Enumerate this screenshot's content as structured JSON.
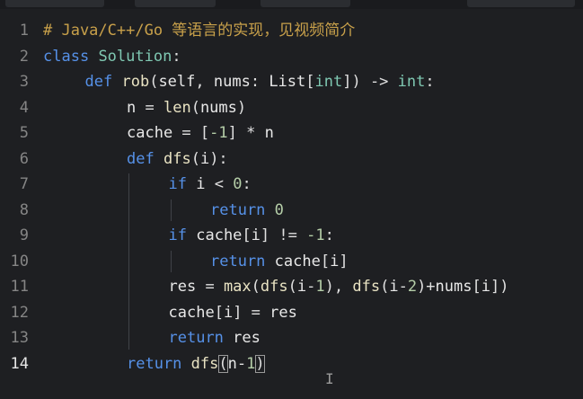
{
  "editor": {
    "language": "python",
    "colors": {
      "background": "#1e1f22",
      "comment": "#c8a04a",
      "keyword": "#5691e8",
      "function": "#e9e3c3",
      "number": "#b5cea8",
      "type": "#7fc8b2",
      "text": "#e8e8e8",
      "line_number": "#858585"
    },
    "current_line": 14,
    "lines": [
      {
        "number": "1",
        "indent": 0,
        "tokens": [
          {
            "t": "# Java/C++/Go 等语言的实现，见视频简介",
            "c": "cmt"
          }
        ]
      },
      {
        "number": "2",
        "indent": 0,
        "tokens": [
          {
            "t": "class",
            "c": "kw"
          },
          {
            "t": " ",
            "c": "op"
          },
          {
            "t": "Solution",
            "c": "typ"
          },
          {
            "t": ":",
            "c": "op"
          }
        ]
      },
      {
        "number": "3",
        "indent": 1,
        "tokens": [
          {
            "t": "def",
            "c": "kw"
          },
          {
            "t": " ",
            "c": "op"
          },
          {
            "t": "rob",
            "c": "fn"
          },
          {
            "t": "(",
            "c": "op"
          },
          {
            "t": "self",
            "c": "id"
          },
          {
            "t": ", ",
            "c": "op"
          },
          {
            "t": "nums",
            "c": "id"
          },
          {
            "t": ": ",
            "c": "op"
          },
          {
            "t": "List",
            "c": "id"
          },
          {
            "t": "[",
            "c": "op"
          },
          {
            "t": "int",
            "c": "typ"
          },
          {
            "t": "]) -> ",
            "c": "op"
          },
          {
            "t": "int",
            "c": "typ"
          },
          {
            "t": ":",
            "c": "op"
          }
        ]
      },
      {
        "number": "4",
        "indent": 2,
        "tokens": [
          {
            "t": "n",
            "c": "id"
          },
          {
            "t": " = ",
            "c": "op"
          },
          {
            "t": "len",
            "c": "fn"
          },
          {
            "t": "(",
            "c": "op"
          },
          {
            "t": "nums",
            "c": "id"
          },
          {
            "t": ")",
            "c": "op"
          }
        ]
      },
      {
        "number": "5",
        "indent": 2,
        "tokens": [
          {
            "t": "cache",
            "c": "id"
          },
          {
            "t": " = [",
            "c": "op"
          },
          {
            "t": "-1",
            "c": "num"
          },
          {
            "t": "] * ",
            "c": "op"
          },
          {
            "t": "n",
            "c": "id"
          }
        ]
      },
      {
        "number": "6",
        "indent": 2,
        "tokens": [
          {
            "t": "def",
            "c": "kw"
          },
          {
            "t": " ",
            "c": "op"
          },
          {
            "t": "dfs",
            "c": "fn"
          },
          {
            "t": "(",
            "c": "op"
          },
          {
            "t": "i",
            "c": "id"
          },
          {
            "t": "):",
            "c": "op"
          }
        ]
      },
      {
        "number": "7",
        "indent": 3,
        "tokens": [
          {
            "t": "if",
            "c": "kw"
          },
          {
            "t": " ",
            "c": "op"
          },
          {
            "t": "i",
            "c": "id"
          },
          {
            "t": " < ",
            "c": "op"
          },
          {
            "t": "0",
            "c": "num"
          },
          {
            "t": ":",
            "c": "op"
          }
        ]
      },
      {
        "number": "8",
        "indent": 4,
        "tokens": [
          {
            "t": "return",
            "c": "kw"
          },
          {
            "t": " ",
            "c": "op"
          },
          {
            "t": "0",
            "c": "num"
          }
        ]
      },
      {
        "number": "9",
        "indent": 3,
        "tokens": [
          {
            "t": "if",
            "c": "kw"
          },
          {
            "t": " ",
            "c": "op"
          },
          {
            "t": "cache",
            "c": "id"
          },
          {
            "t": "[",
            "c": "op"
          },
          {
            "t": "i",
            "c": "id"
          },
          {
            "t": "] != ",
            "c": "op"
          },
          {
            "t": "-1",
            "c": "num"
          },
          {
            "t": ":",
            "c": "op"
          }
        ]
      },
      {
        "number": "10",
        "indent": 4,
        "tokens": [
          {
            "t": "return",
            "c": "kw"
          },
          {
            "t": " ",
            "c": "op"
          },
          {
            "t": "cache",
            "c": "id"
          },
          {
            "t": "[",
            "c": "op"
          },
          {
            "t": "i",
            "c": "id"
          },
          {
            "t": "]",
            "c": "op"
          }
        ]
      },
      {
        "number": "11",
        "indent": 3,
        "tokens": [
          {
            "t": "res",
            "c": "id"
          },
          {
            "t": " = ",
            "c": "op"
          },
          {
            "t": "max",
            "c": "fn"
          },
          {
            "t": "(",
            "c": "op"
          },
          {
            "t": "dfs",
            "c": "fn"
          },
          {
            "t": "(",
            "c": "op"
          },
          {
            "t": "i",
            "c": "id"
          },
          {
            "t": "-",
            "c": "op"
          },
          {
            "t": "1",
            "c": "num"
          },
          {
            "t": "), ",
            "c": "op"
          },
          {
            "t": "dfs",
            "c": "fn"
          },
          {
            "t": "(",
            "c": "op"
          },
          {
            "t": "i",
            "c": "id"
          },
          {
            "t": "-",
            "c": "op"
          },
          {
            "t": "2",
            "c": "num"
          },
          {
            "t": ")+",
            "c": "op"
          },
          {
            "t": "nums",
            "c": "id"
          },
          {
            "t": "[",
            "c": "op"
          },
          {
            "t": "i",
            "c": "id"
          },
          {
            "t": "])",
            "c": "op"
          }
        ]
      },
      {
        "number": "12",
        "indent": 3,
        "tokens": [
          {
            "t": "cache",
            "c": "id"
          },
          {
            "t": "[",
            "c": "op"
          },
          {
            "t": "i",
            "c": "id"
          },
          {
            "t": "] = ",
            "c": "op"
          },
          {
            "t": "res",
            "c": "id"
          }
        ]
      },
      {
        "number": "13",
        "indent": 3,
        "tokens": [
          {
            "t": "return",
            "c": "kw"
          },
          {
            "t": " ",
            "c": "op"
          },
          {
            "t": "res",
            "c": "id"
          }
        ]
      },
      {
        "number": "14",
        "indent": 2,
        "tokens": [
          {
            "t": "return",
            "c": "kw"
          },
          {
            "t": " ",
            "c": "op"
          },
          {
            "t": "dfs",
            "c": "fn"
          },
          {
            "t": "(",
            "c": "op",
            "match": true
          },
          {
            "t": "n",
            "c": "id"
          },
          {
            "t": "-",
            "c": "op"
          },
          {
            "t": "1",
            "c": "num"
          },
          {
            "t": ")",
            "c": "op",
            "match": true
          }
        ]
      }
    ],
    "mouse_cursor_glyph": "I"
  }
}
